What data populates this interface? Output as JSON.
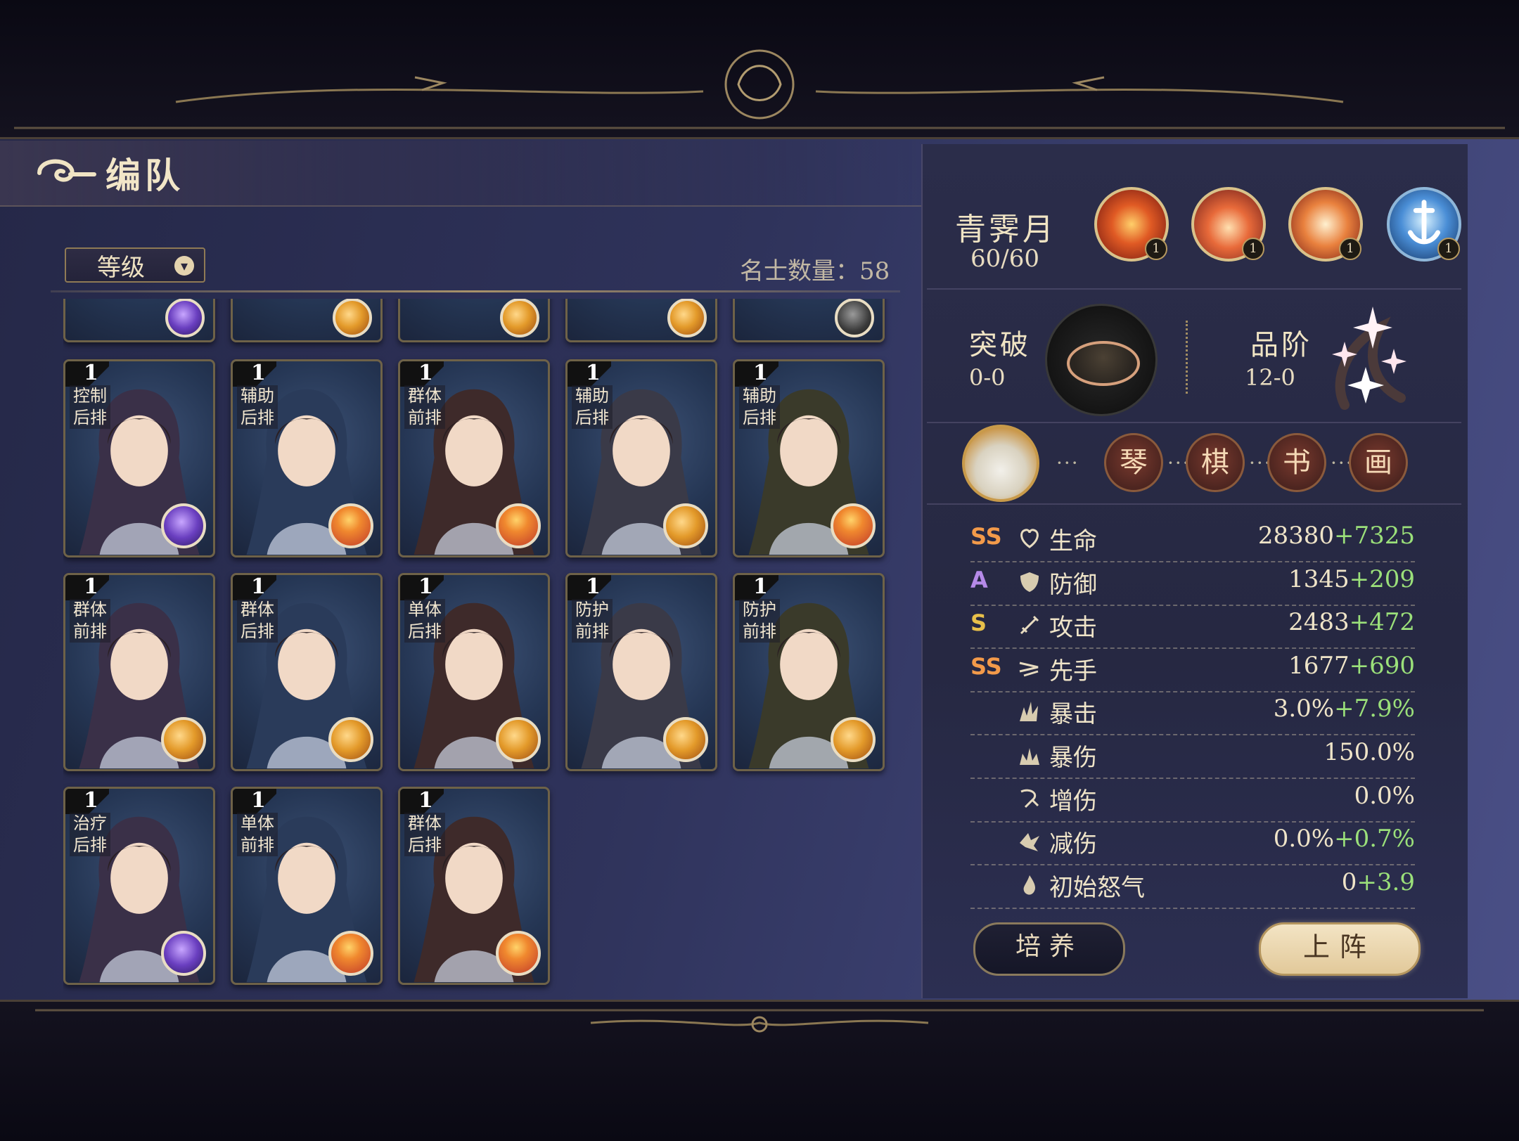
{
  "page": {
    "title": "编队"
  },
  "toolbar": {
    "sort_label": "等级",
    "count_label": "名士数量：58"
  },
  "hero_cards": [
    {
      "level": "1",
      "role1": "控制",
      "role2": "后排",
      "orb": "purple"
    },
    {
      "level": "1",
      "role1": "辅助",
      "role2": "后排",
      "orb": "red"
    },
    {
      "level": "1",
      "role1": "群体",
      "role2": "前排",
      "orb": "red"
    },
    {
      "level": "1",
      "role1": "辅助",
      "role2": "后排",
      "orb": "gold"
    },
    {
      "level": "1",
      "role1": "辅助",
      "role2": "后排",
      "orb": "red"
    },
    {
      "level": "1",
      "role1": "群体",
      "role2": "前排",
      "orb": "gold"
    },
    {
      "level": "1",
      "role1": "群体",
      "role2": "后排",
      "orb": "gold"
    },
    {
      "level": "1",
      "role1": "单体",
      "role2": "后排",
      "orb": "gold"
    },
    {
      "level": "1",
      "role1": "防护",
      "role2": "前排",
      "orb": "gold"
    },
    {
      "level": "1",
      "role1": "防护",
      "role2": "前排",
      "orb": "gold"
    },
    {
      "level": "1",
      "role1": "治疗",
      "role2": "后排",
      "orb": "purple"
    },
    {
      "level": "1",
      "role1": "单体",
      "role2": "前排",
      "orb": "red"
    },
    {
      "level": "1",
      "role1": "群体",
      "role2": "后排",
      "orb": "red"
    }
  ],
  "partial_cards": [
    {
      "orb": "purple"
    },
    {
      "orb": "gold"
    },
    {
      "orb": "gold"
    },
    {
      "orb": "gold"
    },
    {
      "orb": "dark"
    }
  ],
  "hero": {
    "name": "青霁月",
    "level": "60/60",
    "skills": [
      {
        "icon": "flame-slash-icon",
        "count": "1"
      },
      {
        "icon": "fox-spirit-icon",
        "count": "1"
      },
      {
        "icon": "fire-beast-icon",
        "count": "1"
      },
      {
        "icon": "sword-shield-icon",
        "count": "1"
      }
    ],
    "breakthrough": {
      "label": "突破",
      "value": "0-0"
    },
    "grade": {
      "label": "品阶",
      "value": "12-0"
    },
    "arts": [
      "琴",
      "棋",
      "书",
      "画"
    ]
  },
  "stats": [
    {
      "grade": "SS",
      "grade_color": "#f39a4a",
      "icon": "heart-icon",
      "name": "生命",
      "base": "28380",
      "bonus": "+7325"
    },
    {
      "grade": "A",
      "grade_color": "#b58ae8",
      "icon": "shield-icon",
      "name": "防御",
      "base": "1345",
      "bonus": "+209"
    },
    {
      "grade": "S",
      "grade_color": "#e8c04a",
      "icon": "sword-icon",
      "name": "攻击",
      "base": "2483",
      "bonus": "+472"
    },
    {
      "grade": "SS",
      "grade_color": "#f39a4a",
      "icon": "speed-icon",
      "name": "先手",
      "base": "1677",
      "bonus": "+690"
    },
    {
      "grade": "",
      "grade_color": "",
      "icon": "crit-icon",
      "name": "暴击",
      "base": "3.0%",
      "bonus": "+7.9%"
    },
    {
      "grade": "",
      "grade_color": "",
      "icon": "crit-damage-icon",
      "name": "暴伤",
      "base": "150.0%",
      "bonus": ""
    },
    {
      "grade": "",
      "grade_color": "",
      "icon": "damage-up-icon",
      "name": "增伤",
      "base": "0.0%",
      "bonus": ""
    },
    {
      "grade": "",
      "grade_color": "",
      "icon": "damage-reduce-icon",
      "name": "减伤",
      "base": "0.0%",
      "bonus": "+0.7%"
    },
    {
      "grade": "",
      "grade_color": "",
      "icon": "rage-icon",
      "name": "初始怒气",
      "base": "0",
      "bonus": "+3.9"
    }
  ],
  "buttons": {
    "train": "培养",
    "deploy": "上阵"
  }
}
